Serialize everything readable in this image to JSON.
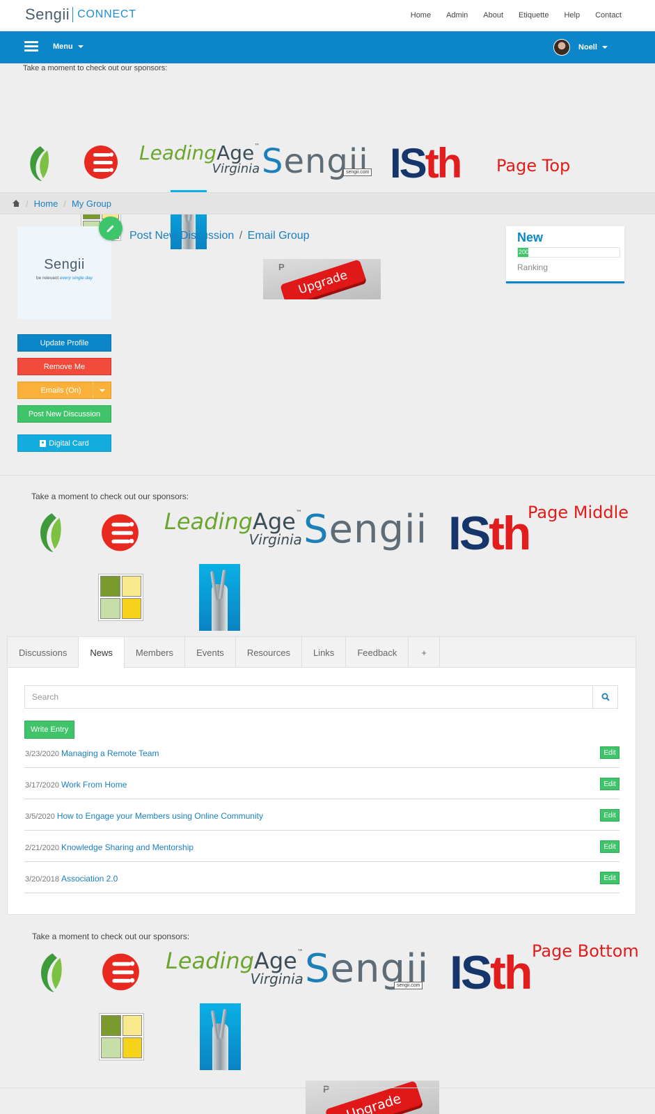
{
  "brand": {
    "name": "Sengii",
    "product": "CONNECT"
  },
  "top_nav": [
    "Home",
    "Admin",
    "About",
    "Etiquette",
    "Help",
    "Contact"
  ],
  "bluebar": {
    "menu_label": "Menu",
    "user_name": "Noell"
  },
  "sponsors": {
    "title": "Take a moment to check out our sponsors:",
    "labels": {
      "top": "Page Top",
      "middle": "Page Middle",
      "bottom": "Page Bottom"
    },
    "leadingage": {
      "lead": "Leading",
      "age": "Age",
      "tm": "™",
      "va": "Virginia"
    },
    "sengii_logo": "engii",
    "sengii_tag": "sengii.com",
    "isth": {
      "is": "IS",
      "th": "th"
    },
    "upgrade": {
      "key": "Upgrade",
      "p": "P"
    }
  },
  "breadcrumb": [
    "Home",
    "My Group"
  ],
  "profile": {
    "card_name": "Sengii",
    "tag_plain": "be relevant",
    "tag_em": "every single day",
    "links": {
      "post": "Post New Discussion",
      "email": "Email Group",
      "sep": "/"
    },
    "buttons": {
      "update": "Update Profile",
      "remove": "Remove Me",
      "emails": "Emails (On)",
      "post": "Post New Discussion",
      "card": "Digital Card"
    }
  },
  "ranking": {
    "status": "New",
    "points": "200",
    "progress_fraction": 0.1,
    "label": "Ranking"
  },
  "tabs": [
    "Discussions",
    "News",
    "Members",
    "Events",
    "Resources",
    "Links",
    "Feedback",
    "+"
  ],
  "active_tab": "News",
  "search": {
    "placeholder": "Search"
  },
  "write_label": "Write Entry",
  "edit_label": "Edit",
  "news": [
    {
      "date": "3/23/2020",
      "title": "Managing a Remote Team"
    },
    {
      "date": "3/17/2020",
      "title": "Work From Home"
    },
    {
      "date": "3/5/2020",
      "title": "How to Engage your Members using Online Community"
    },
    {
      "date": "2/21/2020",
      "title": "Knowledge Sharing and Mentorship"
    },
    {
      "date": "3/20/2018",
      "title": "Association 2.0"
    }
  ],
  "colors": {
    "primary": "#0a86c9",
    "danger": "#f24b3c",
    "warning": "#fbb139",
    "success": "#3fc46a",
    "info": "#14acdf",
    "label_red": "#e41b1b"
  }
}
